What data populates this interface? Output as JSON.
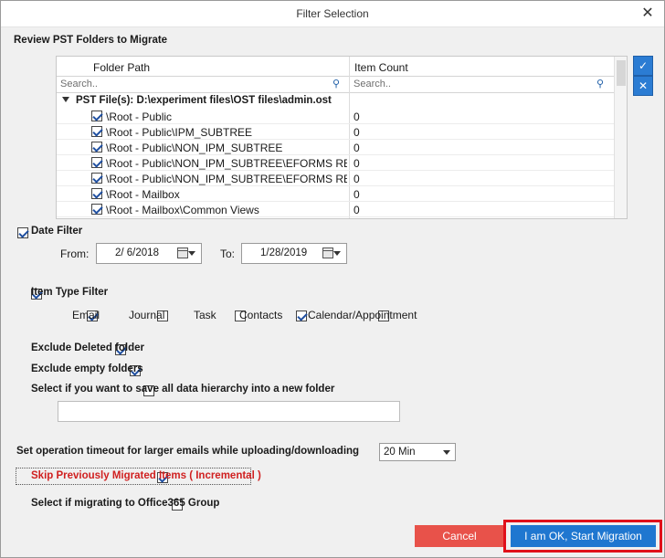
{
  "window": {
    "title": "Filter Selection",
    "close_glyph": "✕"
  },
  "review": {
    "heading": "Review PST Folders to Migrate",
    "columns": {
      "path": "Folder Path",
      "count": "Item Count"
    },
    "search_placeholder": "Search..",
    "root_label": "PST File(s): D:\\experiment files\\OST files\\admin.ost",
    "rows": [
      {
        "path": "\\Root - Public",
        "count": "0",
        "checked": true
      },
      {
        "path": "\\Root - Public\\IPM_SUBTREE",
        "count": "0",
        "checked": true
      },
      {
        "path": "\\Root - Public\\NON_IPM_SUBTREE",
        "count": "0",
        "checked": true
      },
      {
        "path": "\\Root - Public\\NON_IPM_SUBTREE\\EFORMS REGI...",
        "count": "0",
        "checked": true
      },
      {
        "path": "\\Root - Public\\NON_IPM_SUBTREE\\EFORMS REGI...",
        "count": "0",
        "checked": true
      },
      {
        "path": "\\Root - Mailbox",
        "count": "0",
        "checked": true
      },
      {
        "path": "\\Root - Mailbox\\Common Views",
        "count": "0",
        "checked": true
      }
    ],
    "side_buttons": {
      "select_all_icon": "check-all-icon",
      "clear_all_icon": "clear-all-icon"
    }
  },
  "date_filter": {
    "label": "Date Filter",
    "checked": true,
    "from_label": "From:",
    "from_value": "2/  6/2018",
    "to_label": "To:",
    "to_value": "1/28/2019"
  },
  "item_type": {
    "label": "Item Type Filter",
    "checked": true,
    "types": [
      {
        "label": "Email",
        "checked": true
      },
      {
        "label": "Journal",
        "checked": false
      },
      {
        "label": "Task",
        "checked": false
      },
      {
        "label": "Contacts",
        "checked": true
      },
      {
        "label": "Calendar/Appointment",
        "checked": false
      }
    ]
  },
  "options": {
    "exclude_deleted": {
      "label": "Exclude Deleted folder",
      "checked": true
    },
    "exclude_empty": {
      "label": "Exclude empty folders",
      "checked": true
    },
    "save_hierarchy": {
      "label": "Select if you want to save all data hierarchy into a new folder",
      "checked": false,
      "value": ""
    }
  },
  "timeout": {
    "label": "Set operation timeout for larger emails while uploading/downloading",
    "value": "20 Min"
  },
  "skip_migrated": {
    "label": "Skip Previously Migrated Items ( Incremental )",
    "checked": true
  },
  "office365_group": {
    "label": "Select if migrating to Office365 Group",
    "checked": false
  },
  "buttons": {
    "cancel": "Cancel",
    "ok": "I am OK, Start Migration"
  },
  "colors": {
    "accent": "#1f77d0",
    "cancel": "#e8524a",
    "highlight": "#e0101a",
    "warning_text": "#d02020"
  }
}
